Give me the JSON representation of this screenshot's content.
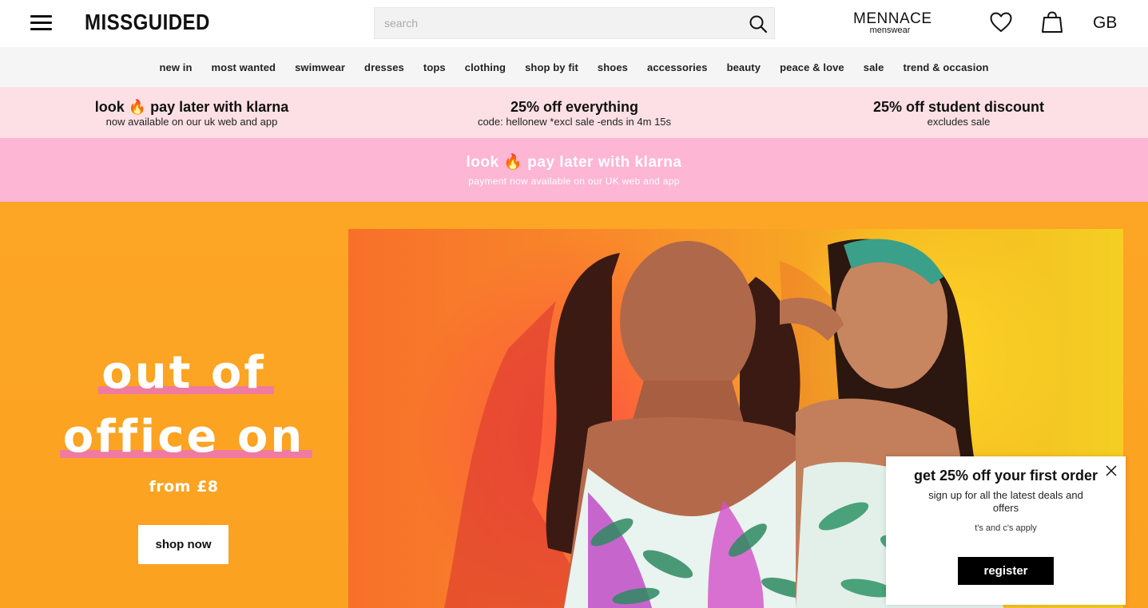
{
  "header": {
    "logo": "MISSGUIDED",
    "search_placeholder": "search",
    "mennace_title": "MENNACE",
    "mennace_sub": "menswear",
    "country": "GB"
  },
  "nav": {
    "items": [
      "new in",
      "most wanted",
      "swimwear",
      "dresses",
      "tops",
      "clothing",
      "shop by fit",
      "shoes",
      "accessories",
      "beauty",
      "peace & love",
      "sale",
      "trend & occasion"
    ]
  },
  "promos": [
    {
      "title": "look 🔥 pay later with klarna",
      "sub": "now available on our uk web and app"
    },
    {
      "title": "25% off everything",
      "sub": "code: hellonew *excl sale -ends in 4m 15s"
    },
    {
      "title": "25% off student discount",
      "sub": "excludes sale"
    }
  ],
  "klarna_banner": {
    "title": "look 🔥 pay later with klarna",
    "sub": "payment now available on our UK web and app"
  },
  "hero": {
    "line1": "out of",
    "line2": "office on",
    "price": "from £8",
    "cta": "shop now"
  },
  "popup": {
    "title": "get 25% off your first order",
    "sub": "sign up for all the latest deals and offers",
    "terms": "t's and c's apply",
    "cta": "register"
  }
}
